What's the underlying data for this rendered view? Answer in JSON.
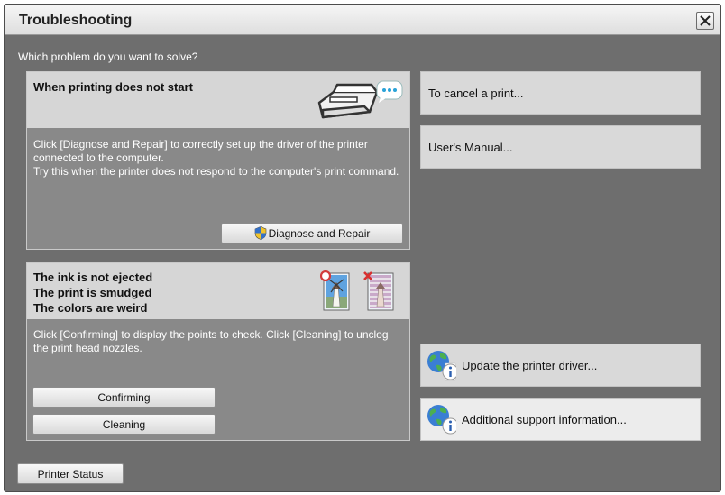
{
  "window": {
    "title": "Troubleshooting",
    "close_icon": "close-icon"
  },
  "prompt": "Which problem do you want to solve?",
  "panel_print": {
    "title": "When printing does not start",
    "description": "Click [Diagnose and Repair] to correctly set up the driver of the printer connected to the computer.\nTry this when the printer does not respond to the computer's print command.",
    "icon": "printer-speech-bubble-icon",
    "diagnose_button": "Diagnose and Repair",
    "diagnose_icon": "uac-shield-icon"
  },
  "panel_ink": {
    "titles": [
      "The ink is not ejected",
      "The print is smudged",
      "The colors are weird"
    ],
    "description": "Click [Confirming] to display the points to check. Click [Cleaning] to unclog the print head nozzles.",
    "good_icon": "good-print-icon",
    "bad_icon": "bad-print-icon",
    "confirming_button": "Confirming",
    "cleaning_button": "Cleaning"
  },
  "side": {
    "cancel_print": "To cancel a print...",
    "users_manual": "User's Manual...",
    "update_driver": "Update the printer driver...",
    "support_info": "Additional support information...",
    "globe_icon": "globe-info-icon"
  },
  "footer": {
    "printer_status": "Printer Status"
  }
}
